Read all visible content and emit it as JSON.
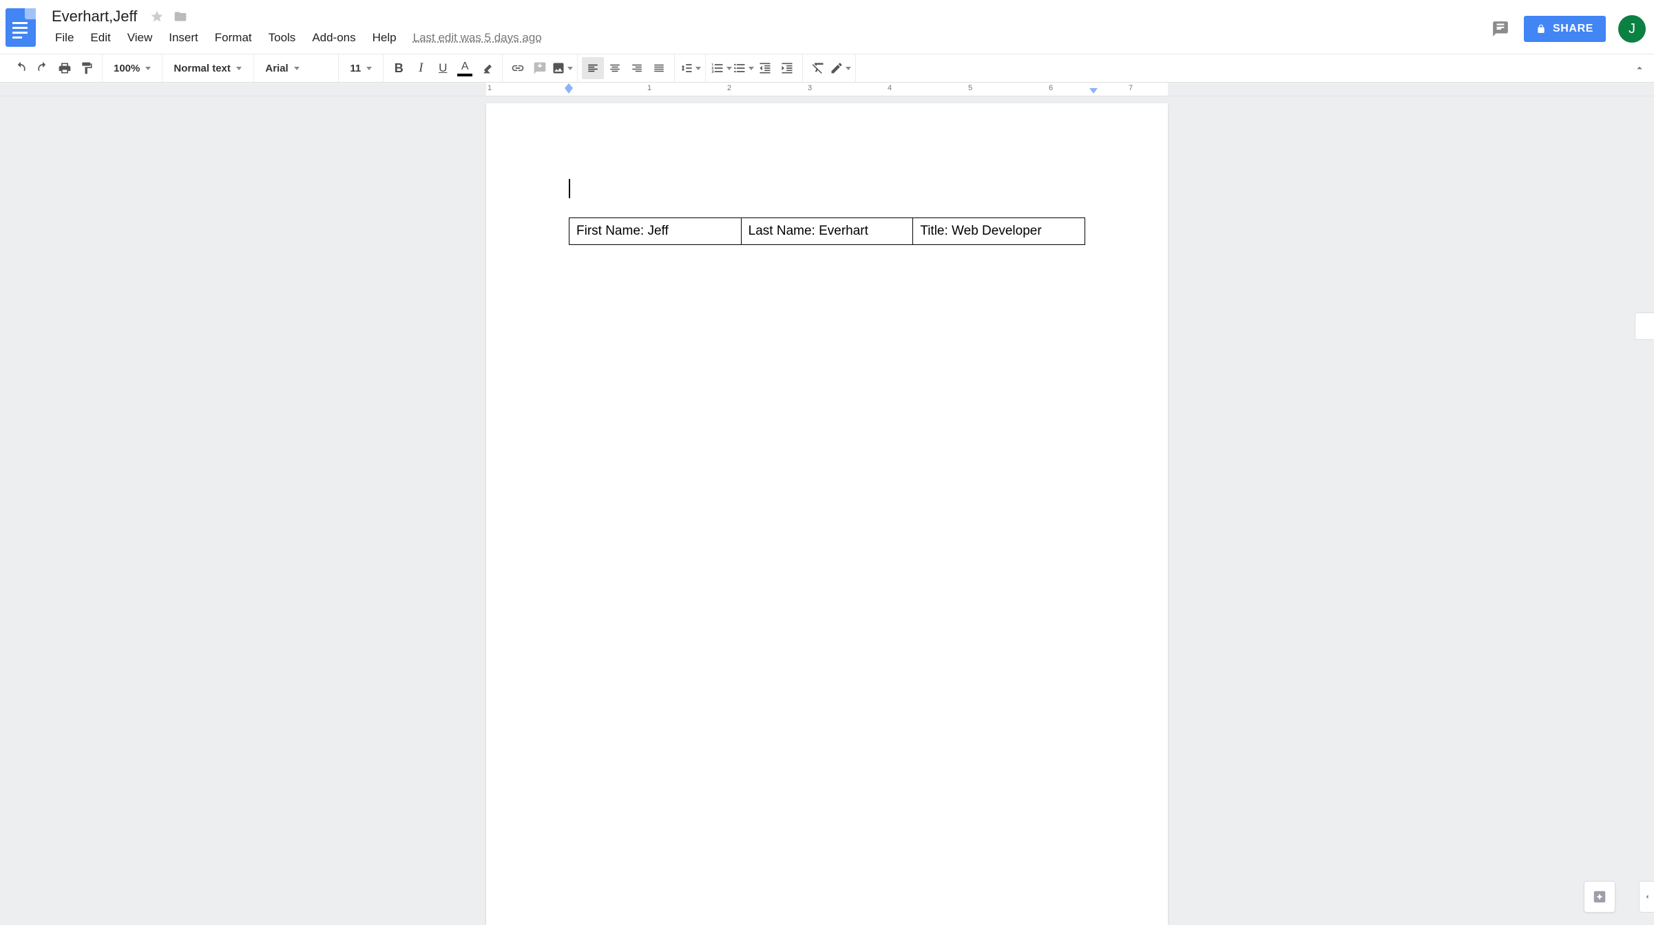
{
  "header": {
    "doc_title": "Everhart,Jeff",
    "avatar_initial": "J",
    "share_label": "SHARE",
    "last_edit": "Last edit was 5 days ago"
  },
  "menus": [
    "File",
    "Edit",
    "View",
    "Insert",
    "Format",
    "Tools",
    "Add-ons",
    "Help"
  ],
  "toolbar": {
    "zoom": "100%",
    "style": "Normal text",
    "font": "Arial",
    "font_size": "11"
  },
  "ruler": {
    "numbers": [
      "1",
      "1",
      "2",
      "3",
      "4",
      "5",
      "6",
      "7"
    ]
  },
  "document": {
    "table_row": [
      "First Name: Jeff",
      "Last Name: Everhart",
      "Title: Web Developer"
    ]
  }
}
